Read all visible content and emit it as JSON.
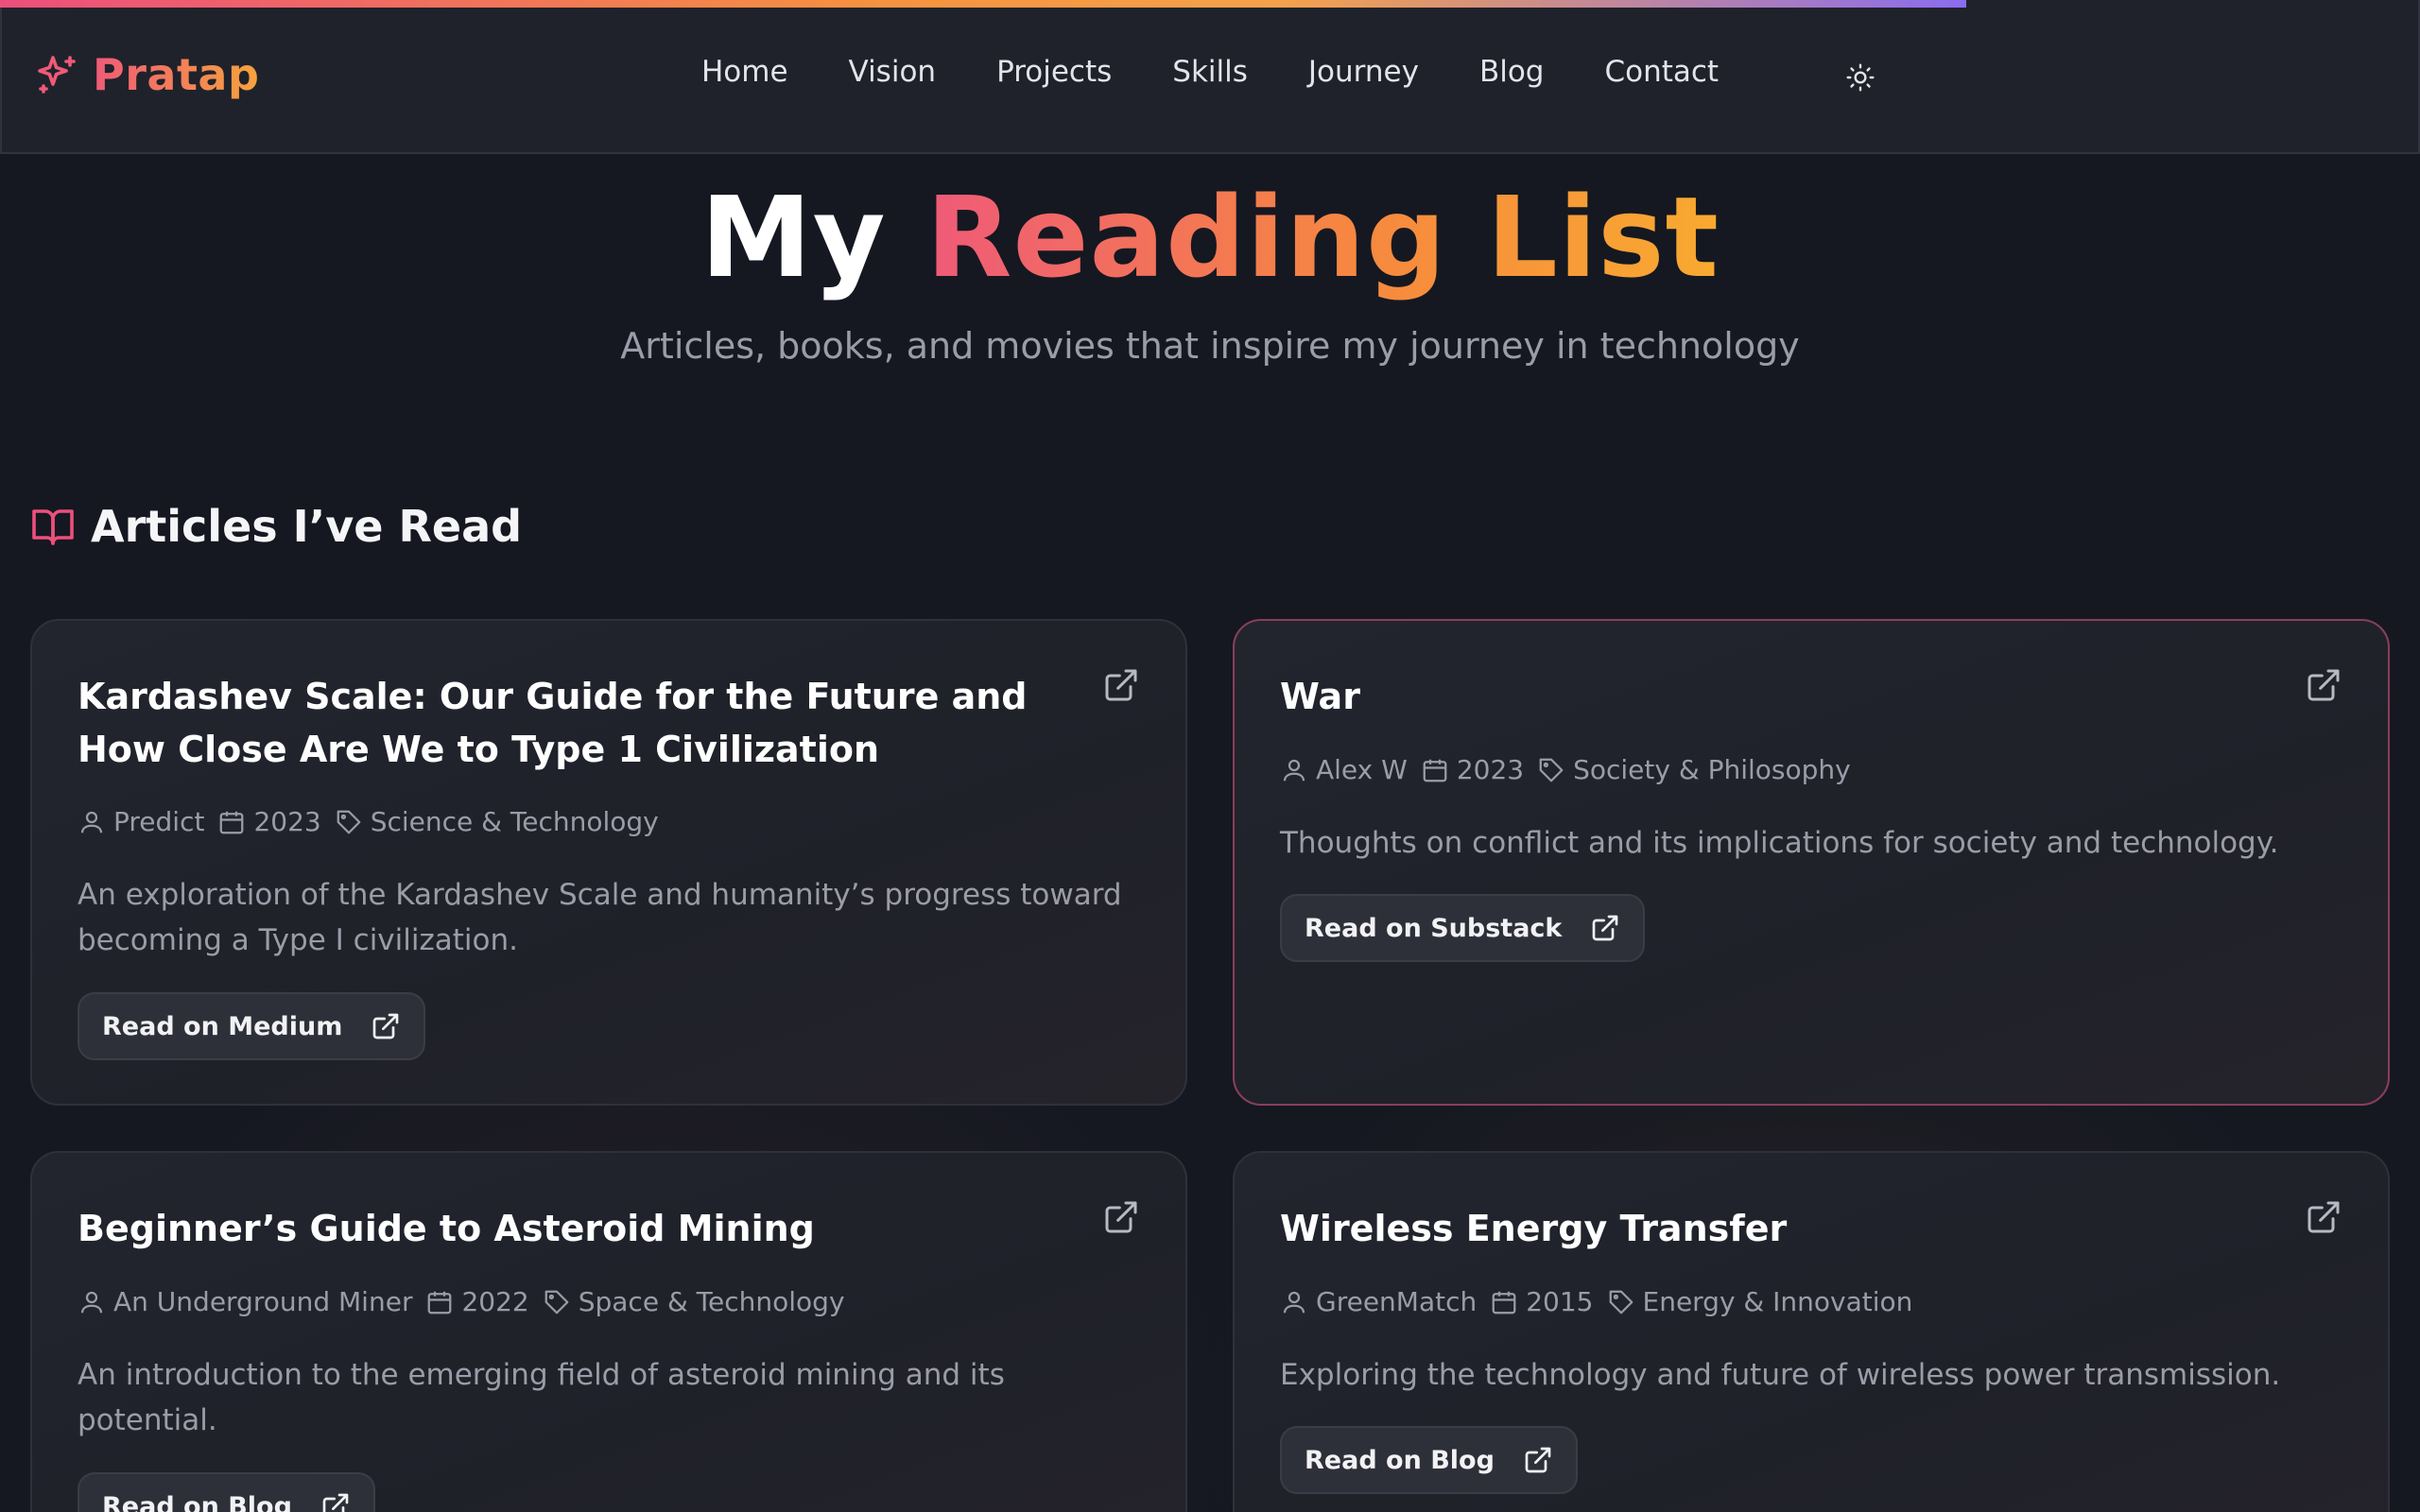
{
  "header": {
    "brand": "Pratap",
    "nav": [
      "Home",
      "Vision",
      "Projects",
      "Skills",
      "Journey",
      "Blog",
      "Contact"
    ],
    "theme_icon": "sun-icon"
  },
  "hero": {
    "title_plain": "My",
    "title_accent": "Reading List",
    "subtitle": "Articles, books, and movies that inspire my journey in technology"
  },
  "section": {
    "icon": "book-open-icon",
    "title": "Articles I’ve Read"
  },
  "articles": [
    {
      "title": "Kardashev Scale: Our Guide for the Future and How Close Are We to Type 1 Civilization",
      "author": "Predict",
      "year": "2023",
      "category": "Science & Technology",
      "description": "An exploration of the Kardashev Scale and humanity’s progress toward becoming a Type I civilization.",
      "button": "Read on Medium"
    },
    {
      "title": "War",
      "author": "Alex W",
      "year": "2023",
      "category": "Society & Philosophy",
      "description": "Thoughts on conflict and its implications for society and technology.",
      "button": "Read on Substack"
    },
    {
      "title": "Beginner’s Guide to Asteroid Mining",
      "author": "An Underground Miner",
      "year": "2022",
      "category": "Space & Technology",
      "description": "An introduction to the emerging field of asteroid mining and its potential.",
      "button": "Read on Blog"
    },
    {
      "title": "Wireless Energy Transfer",
      "author": "GreenMatch",
      "year": "2015",
      "category": "Energy & Innovation",
      "description": "Exploring the technology and future of wireless power transmission.",
      "button": "Read on Blog"
    }
  ],
  "colors": {
    "background": "#151821",
    "accent_pink": "#ef5a78",
    "accent_orange": "#f6a33c",
    "card_border_highlight": "#8a3e5c"
  }
}
